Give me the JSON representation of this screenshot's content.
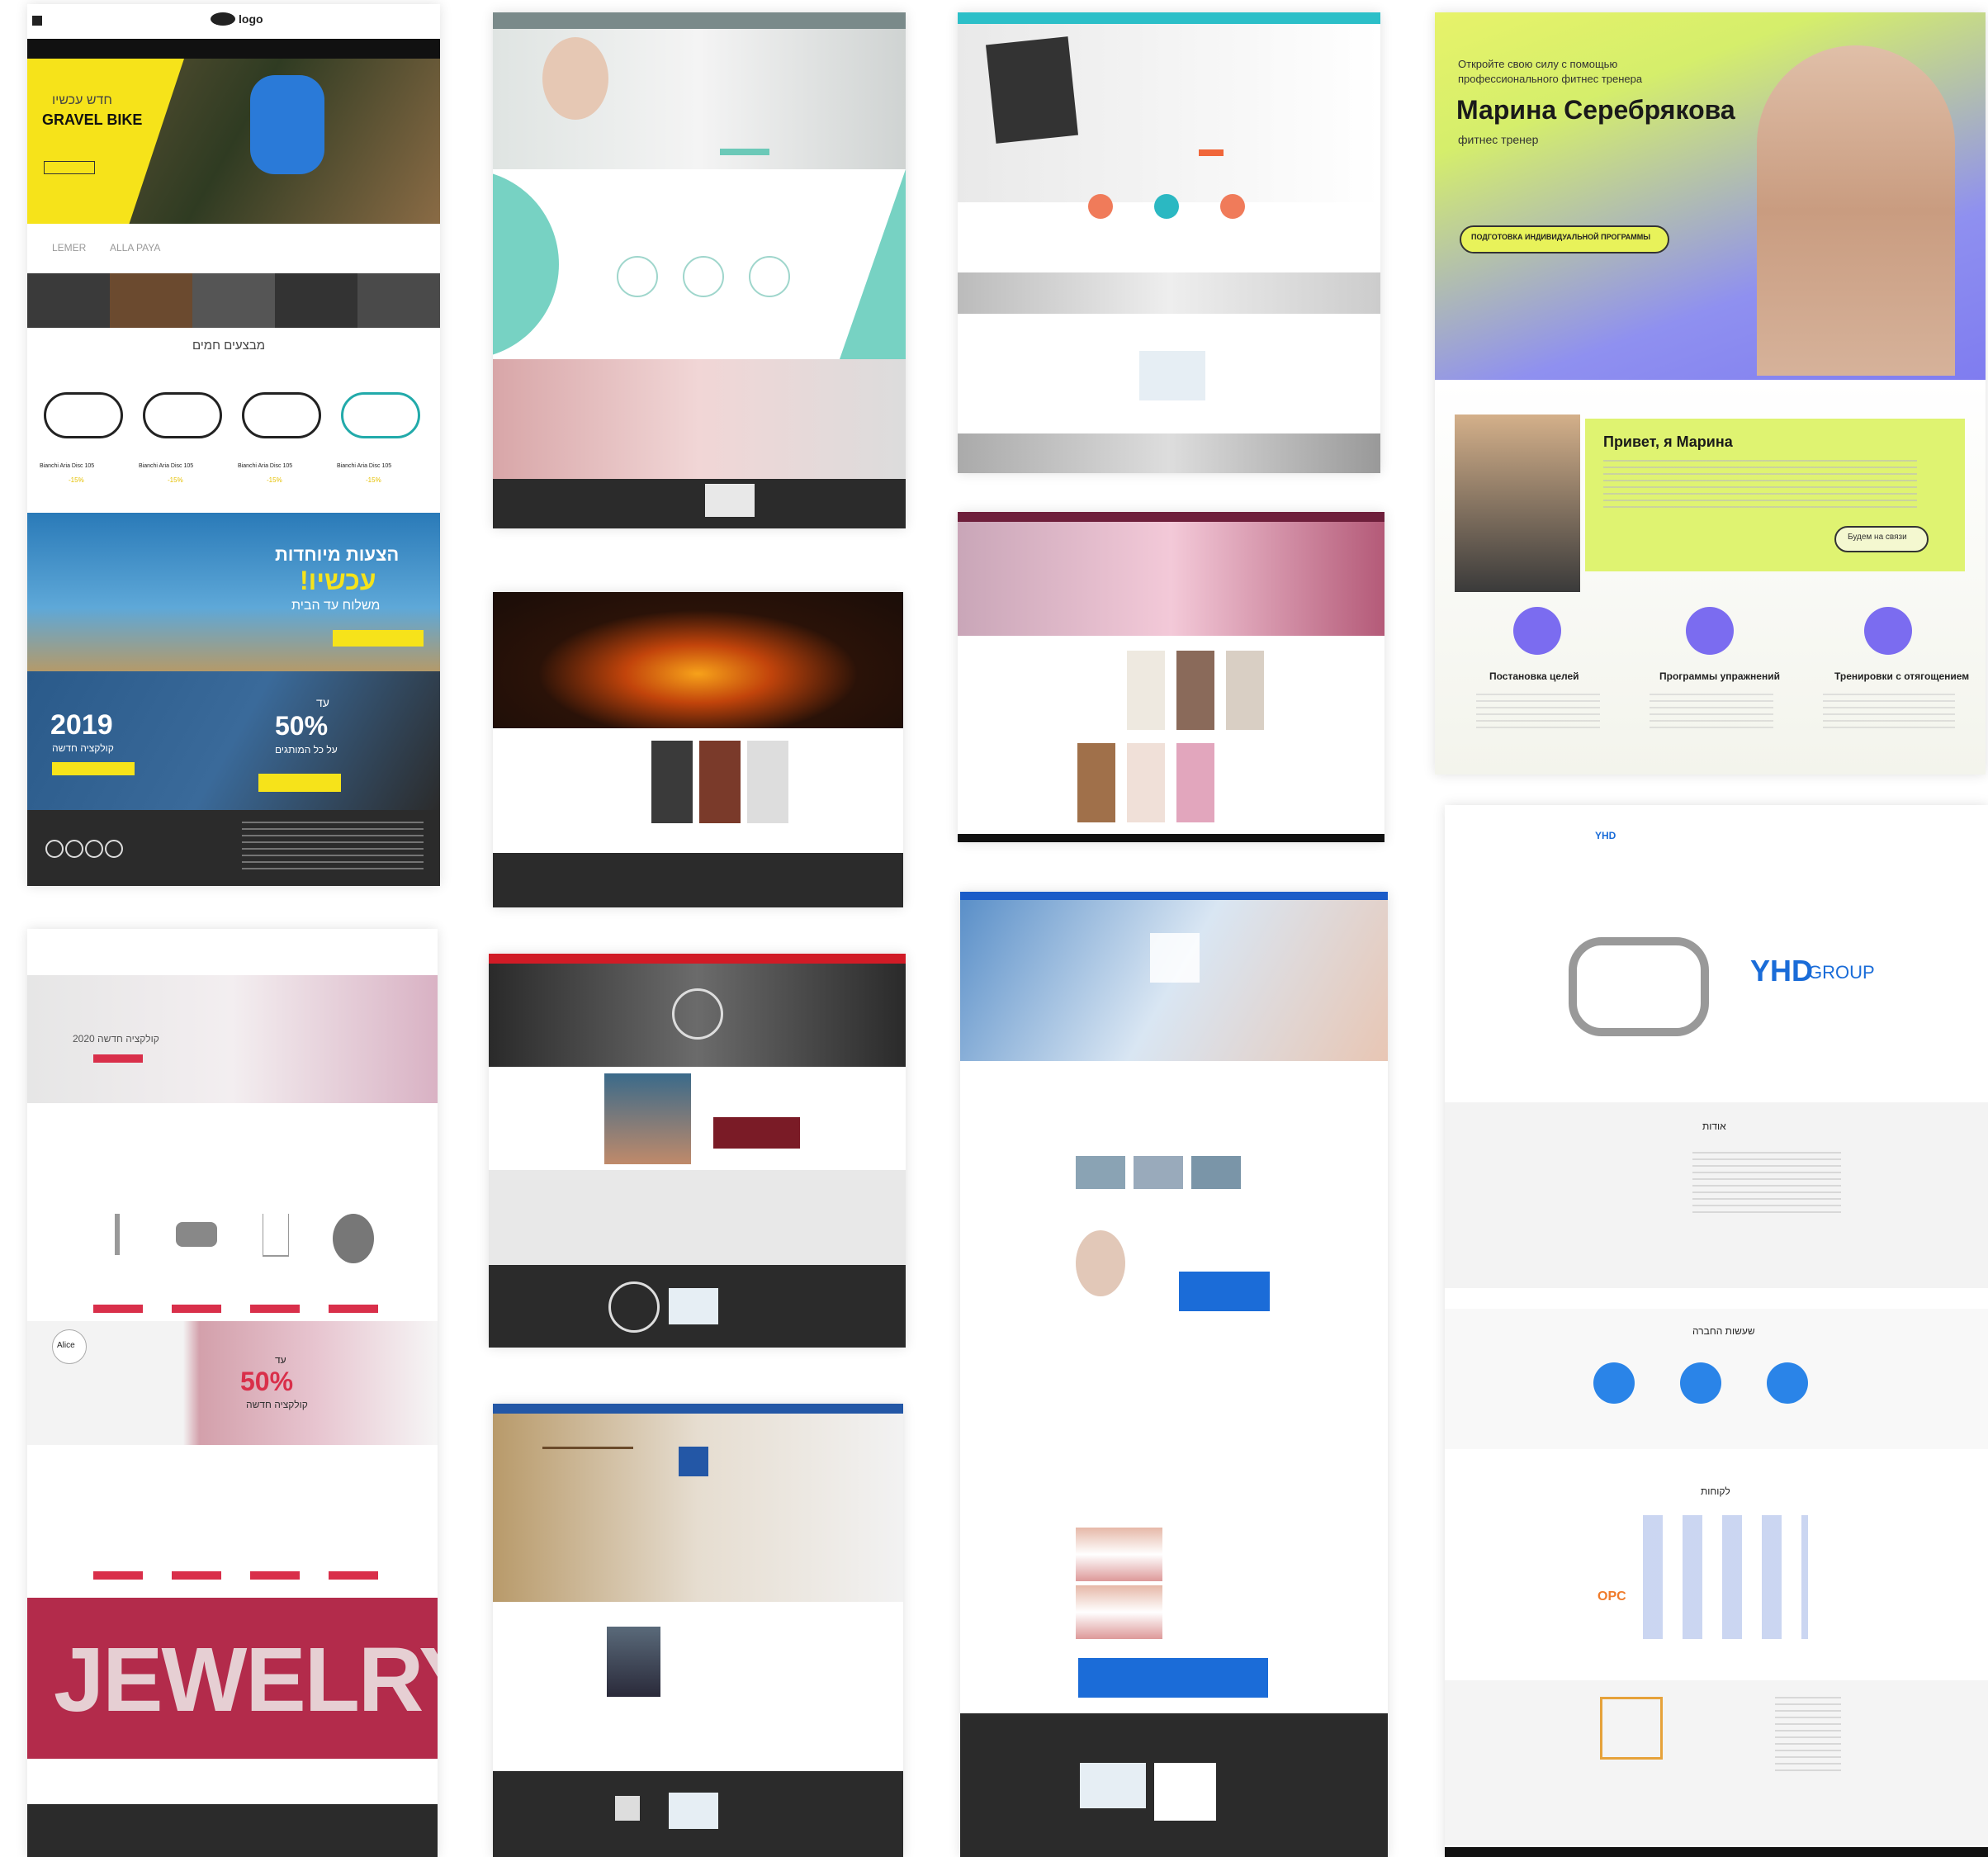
{
  "bike": {
    "logo": "logo",
    "hero_small": "חדש עכשיו",
    "hero_title": "GRAVEL BIKE",
    "brands": [
      "LEMER",
      "ALLA PAYA"
    ],
    "section_title": "מבצעים חמים",
    "product_name": "Bianchi Aria Disc 105",
    "discount": "-15%",
    "promo_title": "הצעות מיוחדות",
    "promo_now": "עכשיו!",
    "promo_sub": "משלוח עד הבית",
    "year": "2019",
    "year_sub": "קולקציה חדשה",
    "sale_prefix": "עד",
    "sale_percent": "50%",
    "sale_sub": "על כל המותגים"
  },
  "jewelry": {
    "hero_text": "קולקציה חדשה 2020",
    "sale_percent": "50%",
    "sale_sub": "קולקציה חדשה",
    "sale_prefix": "עד",
    "logo": "Alice",
    "banner_word": "JEWELRY"
  },
  "fitness": {
    "tagline_1": "Откройте свою силу с помощью",
    "tagline_2": "профессионального фитнес тренера",
    "name": "Марина Серебрякова",
    "role": "фитнес тренер",
    "cta": "ПОДГОТОВКА ИНДИВИДУАЛЬНОЙ ПРОГРАММЫ",
    "greeting": "Привет, я Марина",
    "contact_button": "Будем на связи",
    "features": [
      "Постановка целей",
      "Программы упражнений",
      "Тренировки с отягощением"
    ]
  },
  "yhd": {
    "logo_small": "YHD",
    "logo": "YHD",
    "logo_group": "GROUP",
    "about_title": "אודות",
    "activity_title": "שעשות החברה",
    "clients_title": "לקוחות",
    "clients": [
      "OPC"
    ]
  }
}
